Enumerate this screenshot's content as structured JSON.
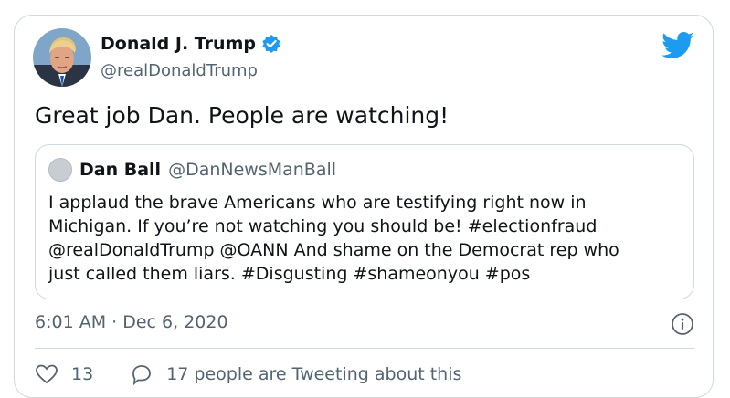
{
  "author": {
    "name": "Donald J. Trump",
    "handle": "@realDonaldTrump",
    "verified": true
  },
  "tweet": {
    "text": "Great job Dan. People are watching!"
  },
  "quoted_tweet": {
    "name": "Dan Ball",
    "handle": "@DanNewsManBall",
    "lines": [
      "I applaud the brave Americans who are testifying right now in",
      "Michigan. If you’re not watching you should be! #electionfraud",
      "@realDonaldTrump @OANN And shame on the Democrat rep who",
      "just called them liars. #Disgusting #shameonyou #pos"
    ]
  },
  "meta": {
    "timestamp": "6:01 AM · Dec 6, 2020"
  },
  "actions": {
    "likes_count": "13",
    "conversation_label": "17 people are Tweeting about this"
  },
  "icons": {
    "logo": "twitter-bird-icon",
    "verified": "verified-badge-icon",
    "info": "info-icon",
    "like": "heart-icon",
    "reply": "speech-bubble-icon"
  },
  "colors": {
    "twitter_blue": "#1d9bf0",
    "secondary_text": "#536471",
    "border": "#cfd9de"
  }
}
